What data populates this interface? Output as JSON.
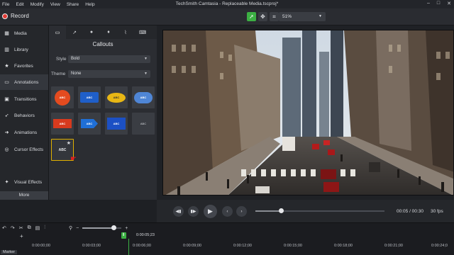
{
  "menu": [
    "File",
    "Edit",
    "Modify",
    "View",
    "Share",
    "Help"
  ],
  "app_title": "TechSmith Camtasia - Replaceable Media.tscproj*",
  "window_controls": [
    "–",
    "□",
    "✕"
  ],
  "record_label": "Record",
  "zoom": "51%",
  "nav": [
    {
      "label": "Media",
      "icon": "media-icon"
    },
    {
      "label": "Library",
      "icon": "library-icon"
    },
    {
      "label": "Favorites",
      "icon": "star-icon"
    },
    {
      "label": "Annotations",
      "icon": "annotations-icon"
    },
    {
      "label": "Transitions",
      "icon": "transitions-icon"
    },
    {
      "label": "Behaviors",
      "icon": "behaviors-icon"
    },
    {
      "label": "Animations",
      "icon": "animations-icon"
    },
    {
      "label": "Cursor Effects",
      "icon": "cursor-icon"
    },
    {
      "label": "Visual Effects",
      "icon": "visual-effects-icon"
    }
  ],
  "active_nav": "Annotations",
  "more_label": "More",
  "panel": {
    "heading": "Callouts",
    "style_label": "Style",
    "style_value": "Bold",
    "theme_label": "Theme",
    "theme_value": "None"
  },
  "callouts": [
    "ABC",
    "ABC",
    "ABC",
    "ABC",
    "ABC",
    "ABC",
    "ABC",
    "ABC",
    "ABC"
  ],
  "accent": "#3cb043",
  "playback": {
    "current": "00:05",
    "total": "00:30",
    "timecode": "00:05 / 00:30",
    "fps": "30 fps",
    "progress": 0.2
  },
  "timeline": {
    "zoom_level": 0.8,
    "playhead": "0:00:05;23",
    "ticks": [
      "0:00:00;00",
      "0:00:03;00",
      "0:00:06;00",
      "0:00:09;00",
      "0:00:12;00",
      "0:00:15;00",
      "0:00:18;00",
      "0:00:21;00",
      "0:00:24;0"
    ],
    "marker_label": "Marker"
  }
}
